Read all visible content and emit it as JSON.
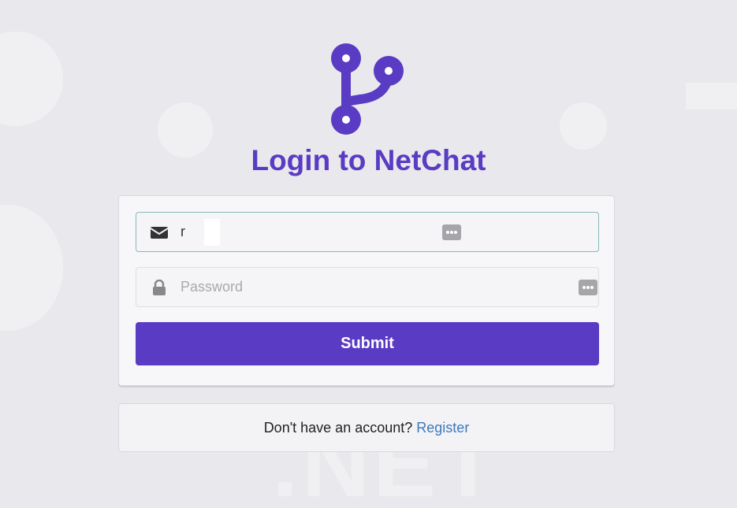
{
  "header": {
    "logo_icon": "branch-icon",
    "title": "Login to NetChat"
  },
  "login_form": {
    "email": {
      "icon": "envelope-icon",
      "value": "r",
      "placeholder": ""
    },
    "password": {
      "icon": "lock-icon",
      "value": "",
      "placeholder": "Password"
    },
    "password_manager_icon": "password-manager-icon",
    "submit_label": "Submit"
  },
  "register": {
    "prompt": "Don't have an account?",
    "link_label": "Register"
  },
  "colors": {
    "brand": "#5a3bc4",
    "link": "#3d78bd",
    "background": "#e9e8ec",
    "focus_border": "#87b8b8"
  }
}
